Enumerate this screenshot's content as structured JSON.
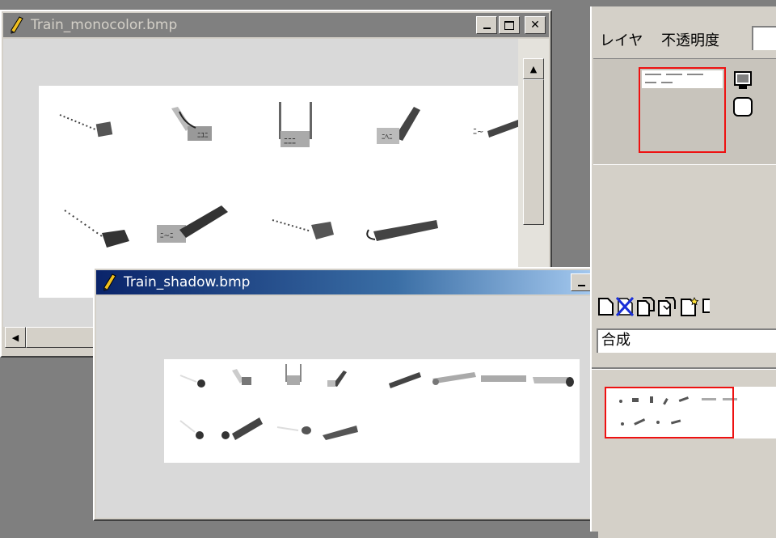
{
  "windows": {
    "monocolor": {
      "title": "Train_monocolor.bmp"
    },
    "shadow": {
      "title": "Train_shadow.bmp"
    }
  },
  "layer_panel": {
    "layer_label": "レイヤ",
    "opacity_label": "不透明度",
    "opacity_value": "",
    "blend_mode": "合成"
  },
  "icons": {
    "app": "pencil-icon",
    "layer_visibility": "monitor-icon",
    "layer_lock": "rounded-square-icon",
    "new_layer": "new-page-icon",
    "delete_layer": "delete-x-icon",
    "duplicate_layer": "copy-page-icon",
    "merge_layer": "merge-icon",
    "layer_properties": "page-star-icon"
  },
  "colors": {
    "accent_red": "#e11111",
    "title_active": "#0a246a",
    "title_inactive": "#808080"
  }
}
